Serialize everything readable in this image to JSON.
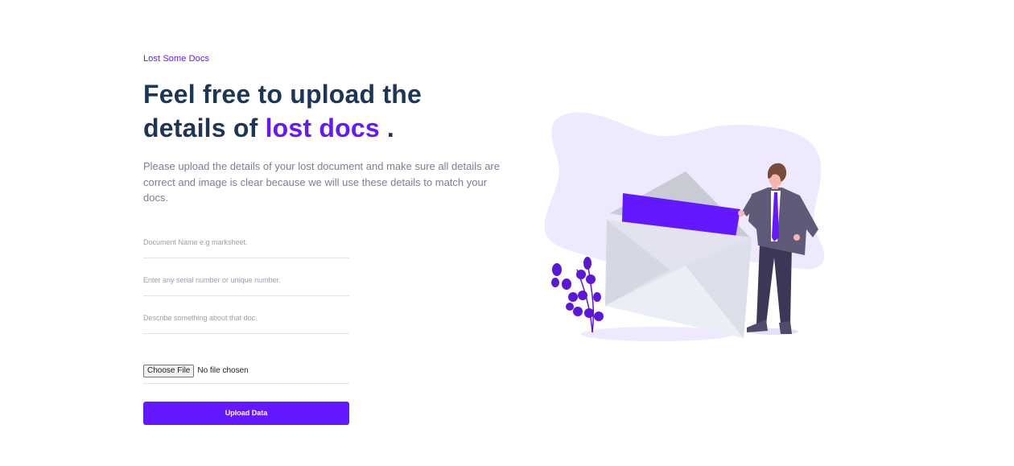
{
  "eyebrow": "Lost Some Docs",
  "headline": {
    "line1": "Feel free to upload the",
    "line2_prefix": "details of ",
    "line2_accent": "lost docs",
    "line2_suffix": " ."
  },
  "description": "Please upload the details of your lost document and make sure all details are correct and image is clear because we will use these details to match your docs.",
  "form": {
    "doc_name_placeholder": "Document Name e.g marksheet.",
    "serial_placeholder": "Enter any serial number or unique number.",
    "describe_placeholder": "Describe something about that doc.",
    "file_button_label": "Choose File",
    "file_status": "No file chosen",
    "submit_label": "Upload Data"
  },
  "colors": {
    "accent": "#6418ff",
    "heading": "#1d3557",
    "body_text": "#7a7f93",
    "blob": "#efe9ff"
  },
  "illustration": {
    "icon": "envelope-man-illustration"
  }
}
